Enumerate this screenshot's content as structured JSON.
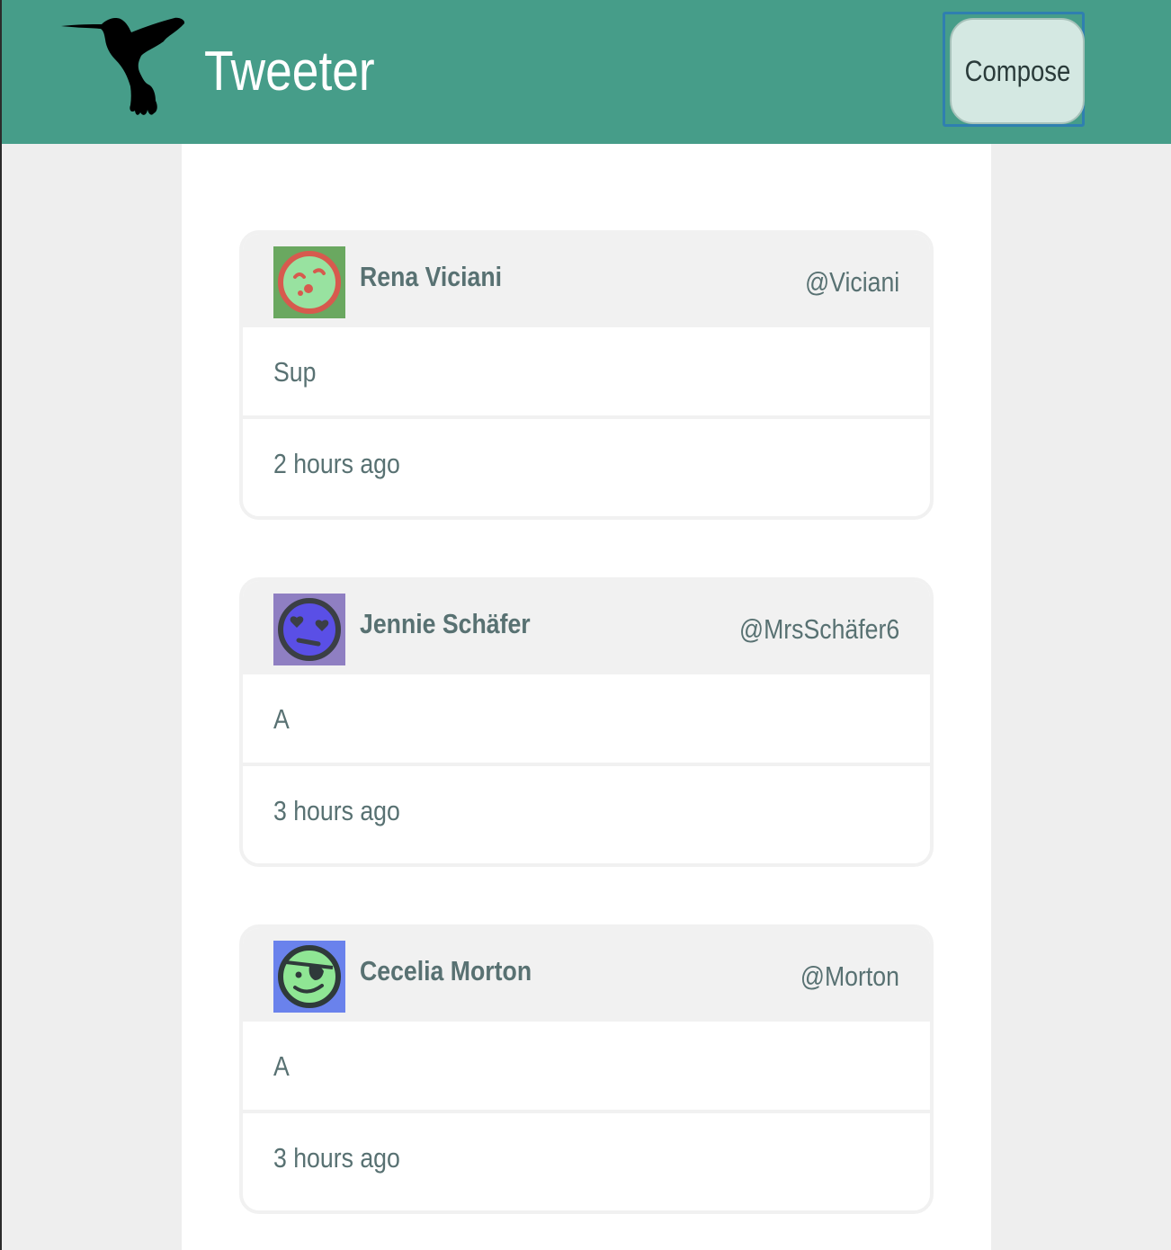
{
  "app": {
    "title": "Tweeter",
    "logo_icon": "hummingbird-icon"
  },
  "nav": {
    "compose_label": "Compose"
  },
  "colors": {
    "navbar": "#469d89",
    "page_background": "#eeeeee",
    "text": "#587172",
    "compose_button": "#d4e8e2",
    "focus_ring": "#2f7fb0"
  },
  "tweets": [
    {
      "name": "Rena Viciani",
      "handle": "@Viciani",
      "text": "Sup",
      "time": "2 hours ago",
      "avatar": {
        "icon": "kissing-face-avatar-icon",
        "background": "#6aa860",
        "face": "#98e2a0",
        "ring": "#d75a4e"
      }
    },
    {
      "name": "Jennie Schäfer",
      "handle": "@MrsSchäfer6",
      "text": "A",
      "time": "3 hours ago",
      "avatar": {
        "icon": "heart-eyes-face-avatar-icon",
        "background": "#8f7fc2",
        "face": "#5a4fe6",
        "ring": "#3b3f45"
      }
    },
    {
      "name": "Cecelia Morton",
      "handle": "@Morton",
      "text": "A",
      "time": "3 hours ago",
      "avatar": {
        "icon": "pirate-face-avatar-icon",
        "background": "#6a82ec",
        "face": "#8fe694",
        "ring": "#2f3a3a"
      }
    }
  ]
}
